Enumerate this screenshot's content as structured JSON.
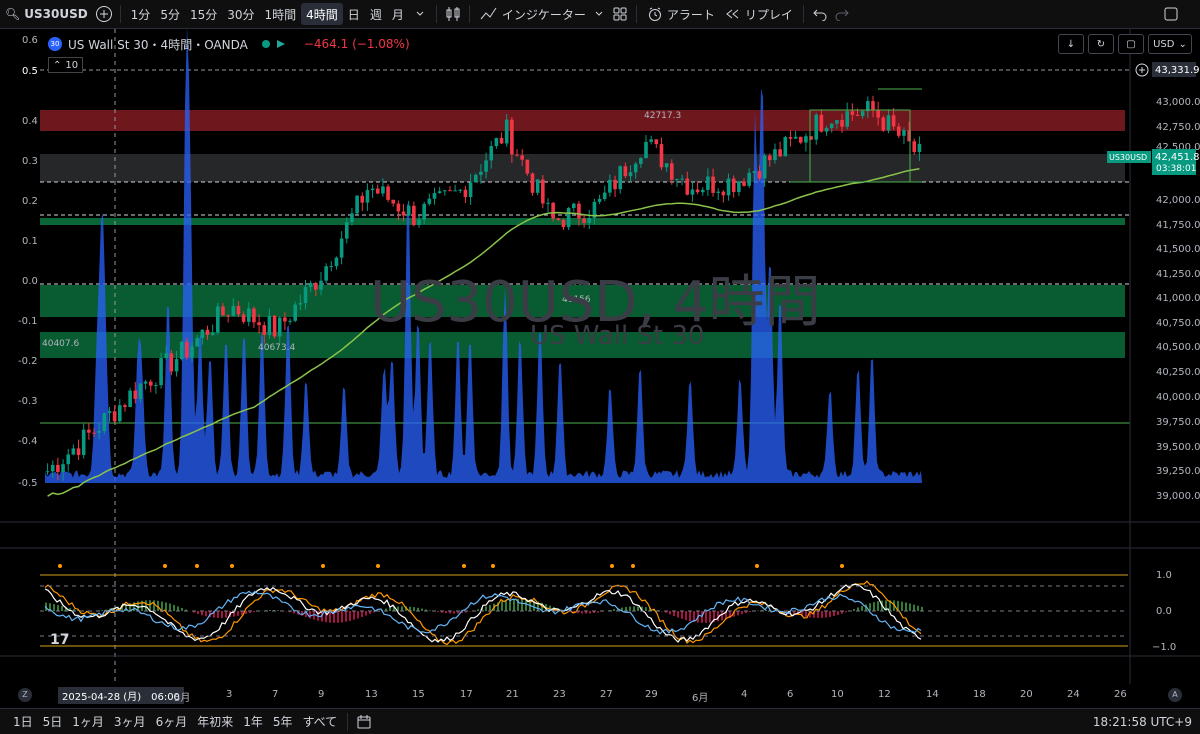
{
  "toolbar": {
    "symbol": "US30USD",
    "timeframes": [
      "1分",
      "5分",
      "15分",
      "30分",
      "1時間",
      "4時間",
      "日",
      "週",
      "月"
    ],
    "active_timeframe": "4時間",
    "indicators_label": "インジケーター",
    "alert_label": "アラート",
    "replay_label": "リプレイ"
  },
  "legend": {
    "badge": "30",
    "title": "US Wall St 30・4時間・OANDA",
    "change": "−464.1 (−1.08%)",
    "volume_setting": "10"
  },
  "right_controls": {
    "currency": "USD"
  },
  "watermark": {
    "symbol": "US30USD, 4時間",
    "name": "US Wall St 30"
  },
  "left_scale": [
    "0.6",
    "0.5",
    "0.4",
    "0.3",
    "0.2",
    "0.1",
    "0.0",
    "-0.1",
    "-0.2",
    "-0.3",
    "-0.4",
    "-0.5"
  ],
  "price_scale": [
    "43,000.0",
    "42,750.0",
    "42,500.0",
    "42,000.0",
    "41,750.0",
    "41,500.0",
    "41,250.0",
    "41,000.0",
    "40,750.0",
    "40,500.0",
    "40,250.0",
    "40,000.0",
    "39,750.0",
    "39,500.0",
    "39,250.0",
    "39,000.0"
  ],
  "price_tags": {
    "top": "43,331.9",
    "symbol_tag": "US30USD",
    "last_price": "42,451.8",
    "countdown": "03:38:01"
  },
  "chart_annotations": [
    "42717.3",
    "40407.6",
    "40673.4",
    "41156"
  ],
  "osc_scale": [
    "1.0",
    "0.0",
    "−1.0"
  ],
  "time_axis": {
    "cursor_label": "2025-04-28 (月)　06:00",
    "labels": [
      "5月",
      "3",
      "7",
      "9",
      "13",
      "15",
      "17",
      "21",
      "23",
      "27",
      "29",
      "6月",
      "4",
      "6",
      "10",
      "12",
      "14",
      "18",
      "20",
      "24",
      "26"
    ]
  },
  "bottom_bar": {
    "ranges": [
      "1日",
      "5日",
      "1ヶ月",
      "3ヶ月",
      "6ヶ月",
      "年初来",
      "1年",
      "5年",
      "すべて"
    ],
    "clock": "18:21:58 UTC+9"
  },
  "colors": {
    "up": "#089981",
    "down": "#f23645",
    "volume": "#2962ff",
    "red_zone": "#8b1d22",
    "green_zone": "#0b6b3a",
    "ma": "#8bc34a"
  },
  "chart_data": {
    "type": "line",
    "title": "US Wall St 30・4時間・OANDA",
    "x": [
      "2025-04-22",
      "2025-04-24",
      "2025-04-28",
      "2025-05-01",
      "2025-05-05",
      "2025-05-07",
      "2025-05-09",
      "2025-05-13",
      "2025-05-15",
      "2025-05-19",
      "2025-05-21",
      "2025-05-23",
      "2025-05-27",
      "2025-05-29",
      "2025-06-02",
      "2025-06-04",
      "2025-06-06",
      "2025-06-10",
      "2025-06-12",
      "2025-06-13"
    ],
    "series": [
      {
        "name": "US Wall St 30",
        "values": [
          39300,
          39700,
          40150,
          40500,
          40950,
          40700,
          41300,
          42150,
          41850,
          42100,
          42700,
          41800,
          41950,
          42600,
          42150,
          42200,
          42500,
          42850,
          42900,
          42450
        ]
      }
    ],
    "ylim": [
      38900,
      43400
    ]
  }
}
